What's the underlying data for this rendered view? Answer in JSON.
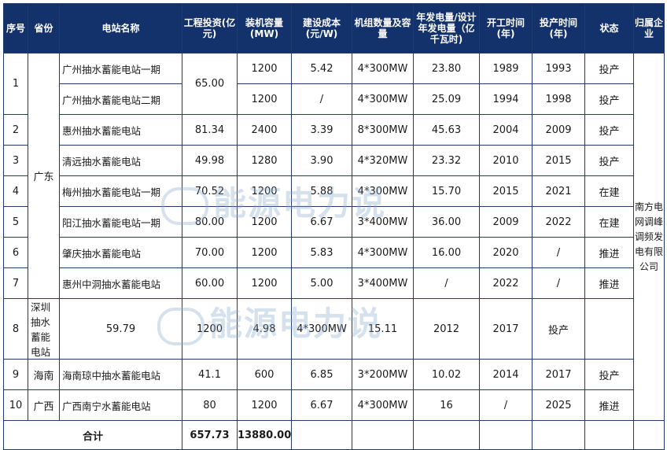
{
  "headers": [
    "序号",
    "省份",
    "电站名称",
    "工程投资(亿元)",
    "装机容量(MW)",
    "建设成本(元/W)",
    "机组数量及容量",
    "年发电量/设计年发电量（亿千瓦时)",
    "开工时间(年)",
    "投产时间(年)",
    "状态",
    "归属企业"
  ],
  "rows": [
    {
      "no": "1",
      "name": "广州抽水蓄能电站一期",
      "invest": "65.00",
      "cap": "1200",
      "cost": "5.42",
      "units": "4*300MW",
      "gen": "23.80",
      "start": "1989",
      "prod": "1993",
      "status": "投产"
    },
    {
      "name": "广州抽水蓄能电站二期",
      "cap": "1200",
      "cost": "/",
      "units": "4*300MW",
      "gen": "25.09",
      "start": "1994",
      "prod": "1998",
      "status": "投产"
    },
    {
      "no": "2",
      "name": "惠州抽水蓄能电站",
      "invest": "81.34",
      "cap": "2400",
      "cost": "3.39",
      "units": "8*300MW",
      "gen": "45.63",
      "start": "2004",
      "prod": "2009",
      "status": "投产"
    },
    {
      "no": "3",
      "name": "清远抽水蓄能电站",
      "invest": "49.98",
      "cap": "1280",
      "cost": "3.90",
      "units": "4*320MW",
      "gen": "23.32",
      "start": "2010",
      "prod": "2015",
      "status": "投产"
    },
    {
      "no": "4",
      "name": "梅州抽水蓄能电站一期",
      "invest": "70.52",
      "cap": "1200",
      "cost": "5.88",
      "units": "4*300MW",
      "gen": "15.70",
      "start": "2015",
      "prod": "2021",
      "status": "在建"
    },
    {
      "no": "5",
      "name": "阳江抽水蓄能电站一期",
      "invest": "80.00",
      "cap": "1200",
      "cost": "6.67",
      "units": "3*400MW",
      "gen": "36.00",
      "start": "2009",
      "prod": "2022",
      "status": "在建"
    },
    {
      "no": "6",
      "name": "肇庆抽水蓄能电站",
      "invest": "70.00",
      "cap": "1200",
      "cost": "5.83",
      "units": "4*300MW",
      "gen": "16.00",
      "start": "2020",
      "prod": "/",
      "status": "推进"
    },
    {
      "no": "7",
      "name": "惠州中洞抽水蓄能电站",
      "invest": "60.00",
      "cap": "1200",
      "cost": "5.00",
      "units": "3*400MW",
      "gen": "/",
      "start": "2022",
      "prod": "/",
      "status": "推进"
    },
    {
      "no": "8",
      "name": "深圳抽水蓄能电站",
      "invest": "59.79",
      "cap": "1200",
      "cost": "4.98",
      "units": "4*300MW",
      "gen": "15.11",
      "start": "2012",
      "prod": "2017",
      "status": "投产"
    },
    {
      "no": "9",
      "name": "海南琼中抽水蓄能电站",
      "invest": "41.1",
      "cap": "600",
      "cost": "6.85",
      "units": "3*200MW",
      "gen": "10.02",
      "start": "2014",
      "prod": "2017",
      "status": "投产"
    },
    {
      "no": "10",
      "name": "广西南宁水蓄能电站",
      "invest": "80",
      "cap": "1200",
      "cost": "6.67",
      "units": "4*300MW",
      "gen": "16",
      "start": "/",
      "prod": "2025",
      "status": "推进"
    }
  ],
  "provinces": {
    "guangdong": "广东",
    "hainan": "海南",
    "guangxi": "广西"
  },
  "company": "南方电网调峰调频发电有限公司",
  "total": {
    "label": "合计",
    "invest": "657.73",
    "cap": "13880.00"
  },
  "watermark": "能源电力说",
  "colors": {
    "header_bg": "#13316b",
    "border": "#1f3a6b"
  }
}
